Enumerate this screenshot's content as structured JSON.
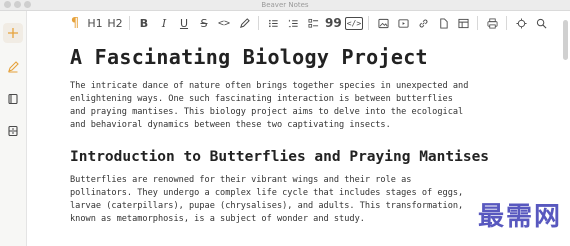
{
  "window": {
    "title": "Beaver Notes"
  },
  "toolbar": {
    "paragraph_label": "¶",
    "h1_label": "H1",
    "h2_label": "H2",
    "bold_label": "B",
    "italic_label": "I",
    "underline_label": "U",
    "strike_label": "S",
    "code_label": "<>",
    "quote_label": "99",
    "codeblock_label": "</>"
  },
  "document": {
    "title": "A Fascinating Biology Project",
    "intro": "The intricate dance of nature often brings together species in unexpected and\nenlightening ways. One such fascinating interaction is between butterflies\nand praying mantises. This biology project aims to delve into the ecological\nand behavioral dynamics between these two captivating insects.",
    "section_heading": "Introduction to Butterflies and Praying Mantises",
    "section_text": "Butterflies are renowned for their vibrant wings and their role as\npollinators. They undergo a complex life cycle that includes stages of eggs,\nlarvae (caterpillars), pupae (chrysalises), and adults. This transformation,\nknown as metamorphosis, is a subject of wonder and study."
  },
  "watermark": "最需网",
  "colors": {
    "accent": "#e6a23c",
    "icon": "#4a4a4a",
    "sidebar": "#f7f7f5"
  }
}
